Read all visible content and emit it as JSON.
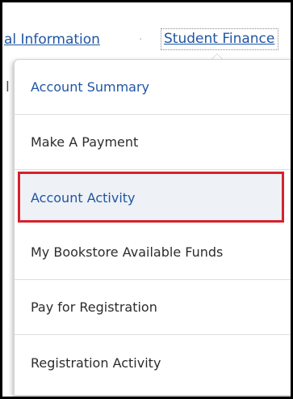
{
  "nav": {
    "personal_info_label": "al Information",
    "separator": "·",
    "student_finance_label": "Student Finance"
  },
  "background": {
    "partial_text": "l"
  },
  "dropdown": {
    "items": [
      {
        "label": "Account Summary",
        "selected": false
      },
      {
        "label": "Make A Payment",
        "selected": false
      },
      {
        "label": "Account Activity",
        "selected": true
      },
      {
        "label": "My Bookstore Available Funds",
        "selected": false
      },
      {
        "label": "Pay for Registration",
        "selected": false
      },
      {
        "label": "Registration Activity",
        "selected": false
      }
    ]
  },
  "colors": {
    "link": "#1f56a3",
    "highlight_border": "#d3232d",
    "highlight_fill": "#eef1f6"
  }
}
